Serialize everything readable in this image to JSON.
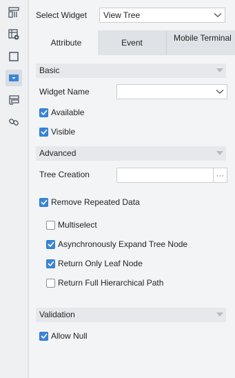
{
  "sidebar": {
    "items": [
      {
        "icon": "layout-icon"
      },
      {
        "icon": "table-settings-icon"
      },
      {
        "icon": "frame-icon"
      },
      {
        "icon": "dropdown-widget-icon"
      },
      {
        "icon": "stack-layers-icon"
      },
      {
        "icon": "link-icon"
      }
    ]
  },
  "header": {
    "select_widget_label": "Select Widget",
    "select_widget_value": "View Tree"
  },
  "tabs": [
    {
      "label": "Attribute",
      "active": true
    },
    {
      "label": "Event",
      "active": false
    },
    {
      "label": "Mobile Terminal",
      "active": false
    }
  ],
  "basic": {
    "title": "Basic",
    "widget_name_label": "Widget Name",
    "widget_name_value": "",
    "available_label": "Available",
    "available_checked": true,
    "visible_label": "Visible",
    "visible_checked": true
  },
  "advanced": {
    "title": "Advanced",
    "tree_creation_label": "Tree Creation",
    "tree_creation_value": "",
    "tree_creation_button": "···",
    "remove_repeated_label": "Remove Repeated Data",
    "remove_repeated_checked": true,
    "multiselect_label": "Multiselect",
    "multiselect_checked": false,
    "async_expand_label": "Asynchronously Expand Tree Node",
    "async_expand_checked": true,
    "return_leaf_label": "Return Only Leaf Node",
    "return_leaf_checked": true,
    "return_full_path_label": "Return Full Hierarchical Path",
    "return_full_path_checked": false
  },
  "validation": {
    "title": "Validation",
    "allow_null_label": "Allow Null",
    "allow_null_checked": true
  },
  "colors": {
    "accent": "#3a86d8",
    "panel_bg": "#f3f4f6",
    "section_bg": "#e6e8eb",
    "sidebar_bg": "#eef0f2"
  }
}
